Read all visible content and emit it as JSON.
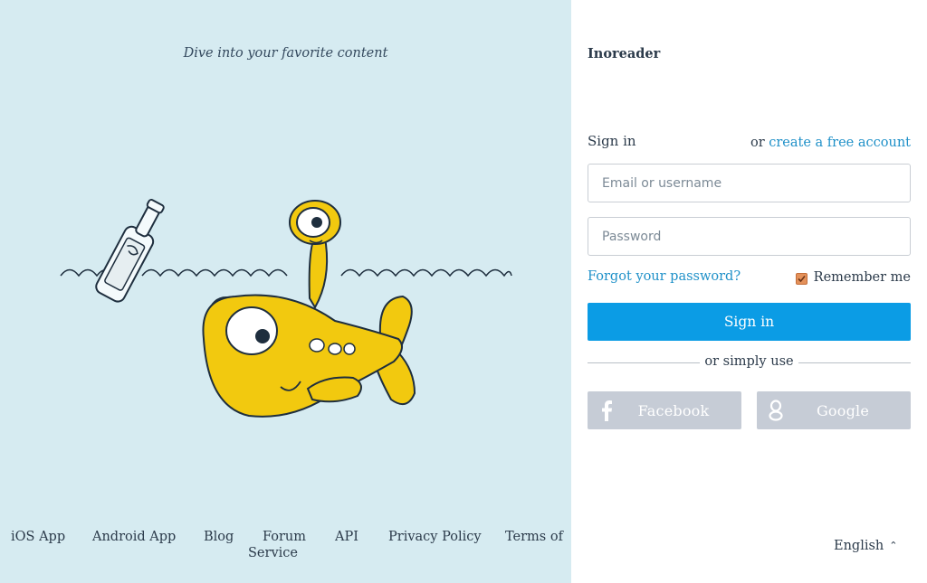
{
  "left": {
    "tagline": "Dive into your favorite content",
    "footer": {
      "ios": "iOS App",
      "android": "Android App",
      "blog": "Blog",
      "forum": "Forum",
      "api": "API",
      "privacy": "Privacy Policy",
      "terms_line1": "Terms of",
      "terms_line2": "Service"
    }
  },
  "right": {
    "brand": "Inoreader",
    "signin_label": "Sign in",
    "or_text": "or",
    "create_account": "create a free account",
    "email_placeholder": "Email or username",
    "password_placeholder": "Password",
    "forgot": "Forgot your password?",
    "remember": "Remember me",
    "remember_checked": true,
    "signin_button": "Sign in",
    "simply_use": "or simply use",
    "facebook": "Facebook",
    "google": "Google",
    "language": "English"
  },
  "colors": {
    "left_bg": "#d6ebf1",
    "primary_button": "#0b9ce5",
    "link": "#1e90c8",
    "social_button": "#c6ccd6",
    "checkbox": "#e4915a"
  },
  "icons": {
    "facebook": "facebook-icon",
    "google": "google-icon",
    "caret": "chevron-up-icon",
    "illustration": "fish-and-bottle-illustration"
  }
}
